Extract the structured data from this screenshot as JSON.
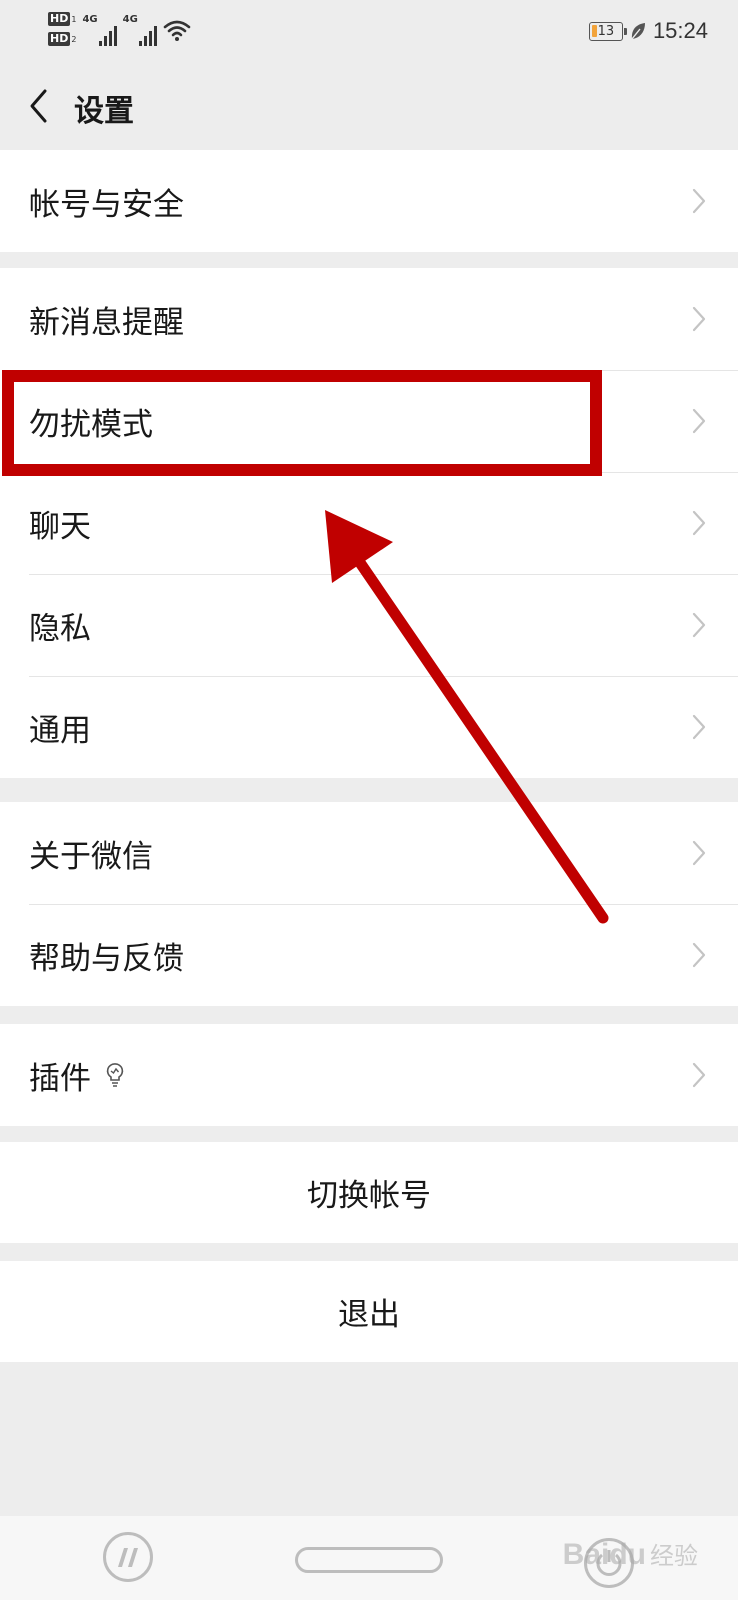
{
  "status_bar": {
    "sim1": "HD",
    "sim1_index": "1",
    "sim2": "HD",
    "sim2_index": "2",
    "net1": "4G",
    "net2": "4G",
    "battery_level": "13",
    "time": "15:24"
  },
  "nav": {
    "back_icon": "chevron-left-icon",
    "title": "设置"
  },
  "groups": [
    {
      "items": [
        {
          "label": "帐号与安全"
        }
      ]
    },
    {
      "items": [
        {
          "label": "新消息提醒"
        },
        {
          "label": "勿扰模式",
          "highlighted": true
        },
        {
          "label": "聊天"
        },
        {
          "label": "隐私"
        },
        {
          "label": "通用"
        }
      ]
    },
    {
      "items": [
        {
          "label": "关于微信"
        },
        {
          "label": "帮助与反馈"
        }
      ]
    },
    {
      "items": [
        {
          "label": "插件",
          "icon": "lightbulb-icon"
        }
      ]
    }
  ],
  "actions": {
    "switch_account": "切换帐号",
    "logout": "退出"
  },
  "annotation": {
    "color": "#c00000",
    "target": "勿扰模式"
  },
  "watermark": {
    "brand": "Baidu",
    "suffix": "经验"
  },
  "colors": {
    "background": "#ededed",
    "surface": "#ffffff",
    "text": "#191919",
    "chevron": "#c4c4c4"
  }
}
